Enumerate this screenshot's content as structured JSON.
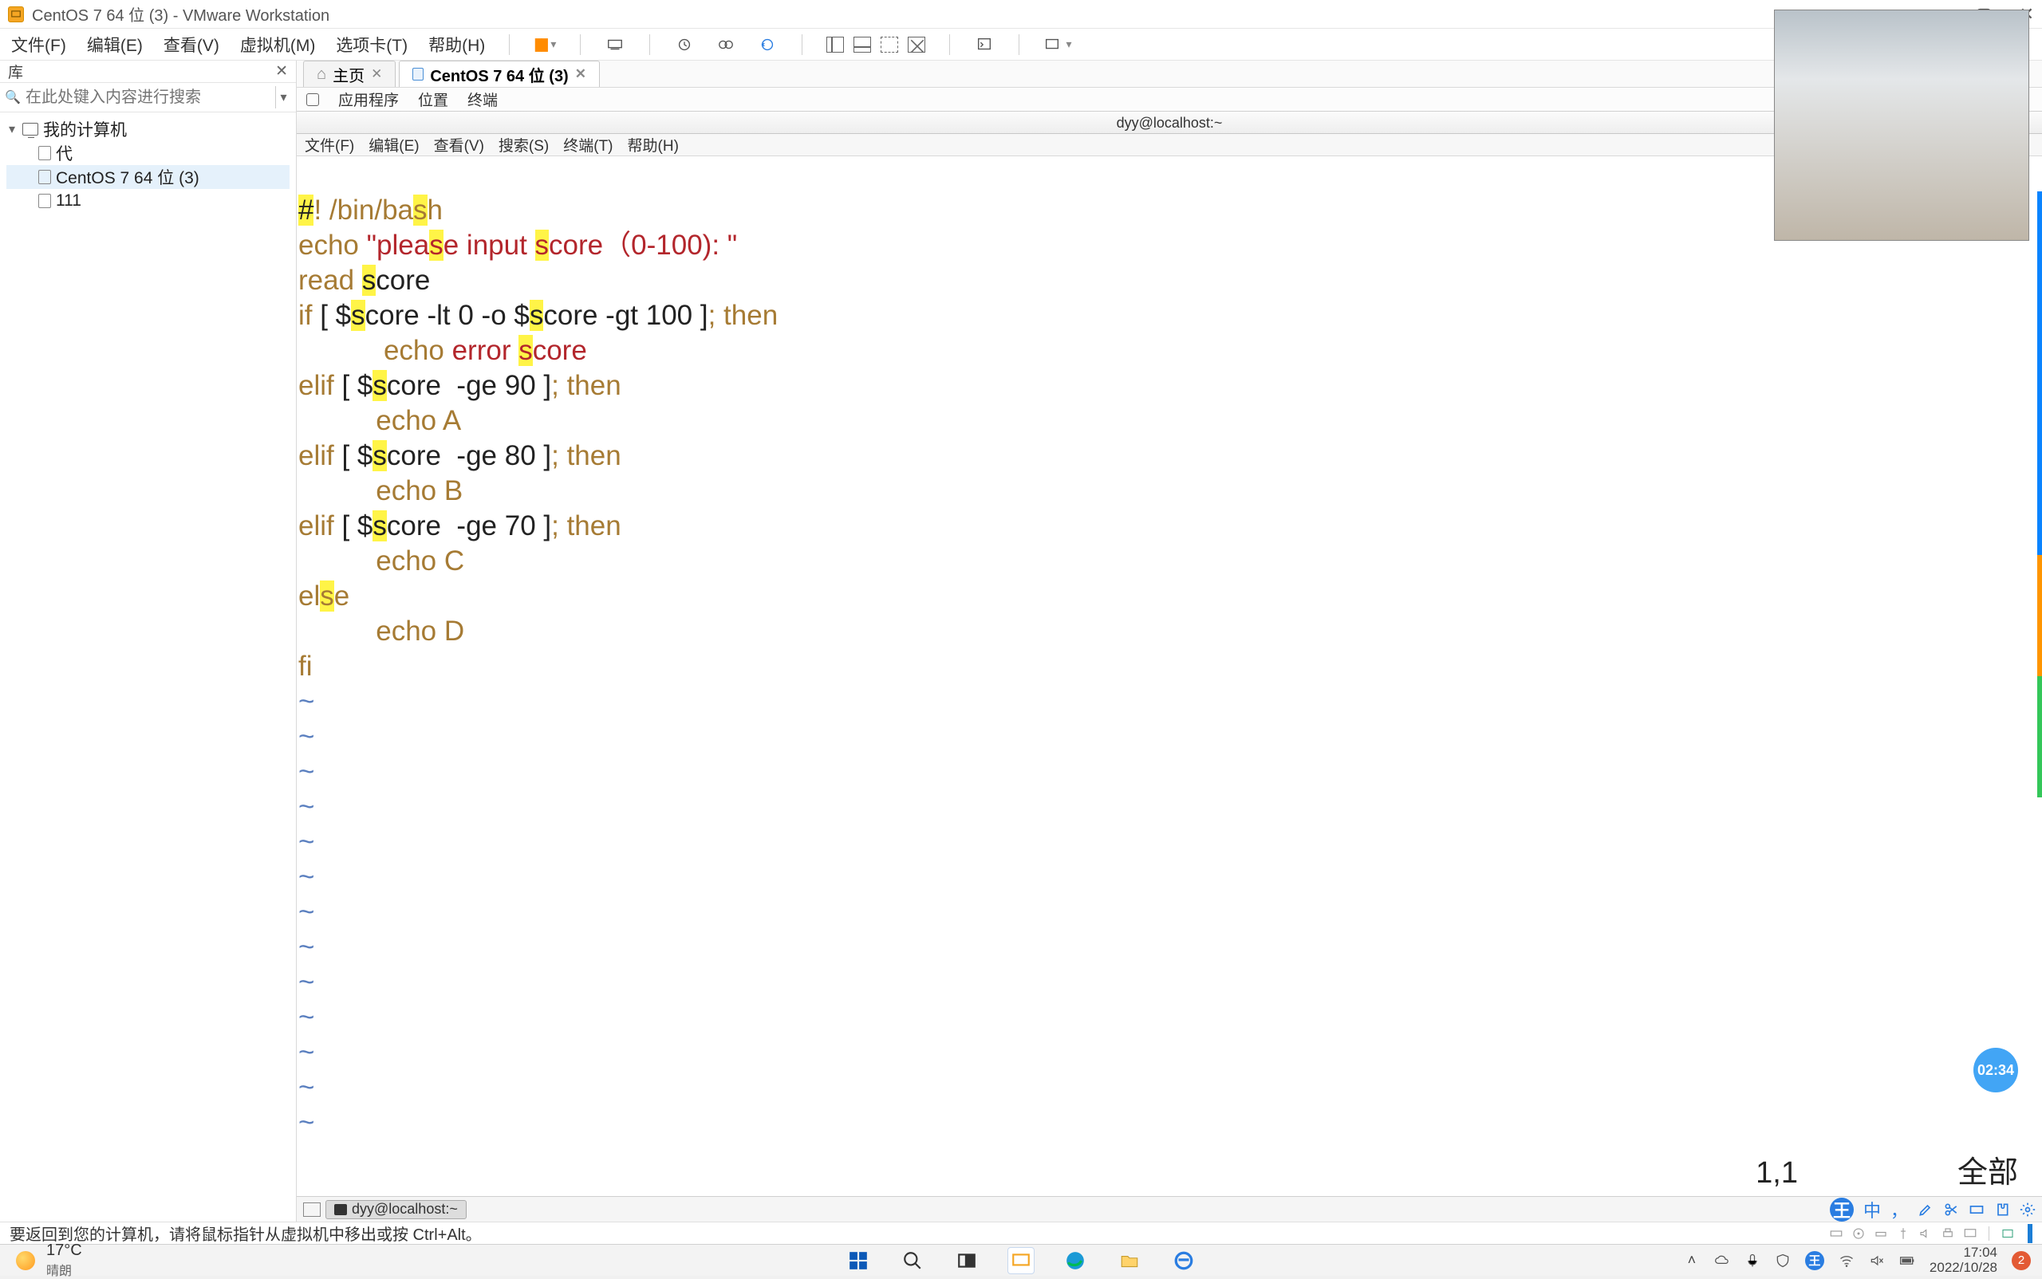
{
  "window": {
    "title": "CentOS 7 64 位 (3) - VMware Workstation"
  },
  "menu": {
    "file": "文件(F)",
    "edit": "编辑(E)",
    "view": "查看(V)",
    "vm": "虚拟机(M)",
    "tabs": "选项卡(T)",
    "help": "帮助(H)"
  },
  "sidebar": {
    "header": "库",
    "search_placeholder": "在此处键入内容进行搜索",
    "root": "我的计算机",
    "items": [
      "代",
      "CentOS 7 64 位 (3)",
      "111"
    ]
  },
  "tabs": {
    "home": "主页",
    "vm": "CentOS 7 64 位 (3)"
  },
  "gnome": {
    "apps": "应用程序",
    "places": "位置",
    "terminal": "终端"
  },
  "term_title": "dyy@localhost:~",
  "term_menu": {
    "file": "文件(F)",
    "edit": "编辑(E)",
    "view": "查看(V)",
    "search": "搜索(S)",
    "terminal": "终端(T)",
    "help": "帮助(H)"
  },
  "code": {
    "l1a": "#",
    "l1b": "! /bin/ba",
    "l1c": "s",
    "l1d": "h",
    "l2a": "echo ",
    "l2b": "\"plea",
    "l2c": "s",
    "l2d": "e input ",
    "l2e": "s",
    "l2f": "core",
    "l2g": "（0-100): \"",
    "l3a": "read ",
    "l3b": "s",
    "l3c": "core",
    "l4a": "if ",
    "l4b": "[ $",
    "l4c": "s",
    "l4d": "core -lt 0 -o $",
    "l4e": "s",
    "l4f": "core -gt 100 ]",
    "l4g": "; then",
    "l5a": "           echo ",
    "l5b": "error ",
    "l5c": "s",
    "l5d": "core",
    "l6a": "elif ",
    "l6b": "[ $",
    "l6c": "s",
    "l6d": "core  -ge 90 ]",
    "l6e": "; then",
    "l7": "          echo A",
    "l8a": "elif ",
    "l8b": "[ $",
    "l8c": "s",
    "l8d": "core  -ge 80 ]",
    "l8e": "; then",
    "l9": "          echo B",
    "l10a": "elif ",
    "l10b": "[ $",
    "l10c": "s",
    "l10d": "core  -ge 70 ]",
    "l10e": "; then",
    "l11": "          echo C",
    "l12a": "el",
    "l12b": "s",
    "l12c": "e",
    "l13": "          echo D",
    "l14": "fi",
    "tilde": "~"
  },
  "vim_status": {
    "pos": "1,1",
    "mode": "全部"
  },
  "gnome_task": {
    "term": "dyy@localhost:~"
  },
  "vmware_hint": "要返回到您的计算机，请将鼠标指针从虚拟机中移出或按 Ctrl+Alt。",
  "float_timer": "02:34",
  "win": {
    "temp": "17°C",
    "cond": "晴朗",
    "ime": "中",
    "time": "17:04",
    "date": "2022/10/28",
    "notif": "2"
  }
}
